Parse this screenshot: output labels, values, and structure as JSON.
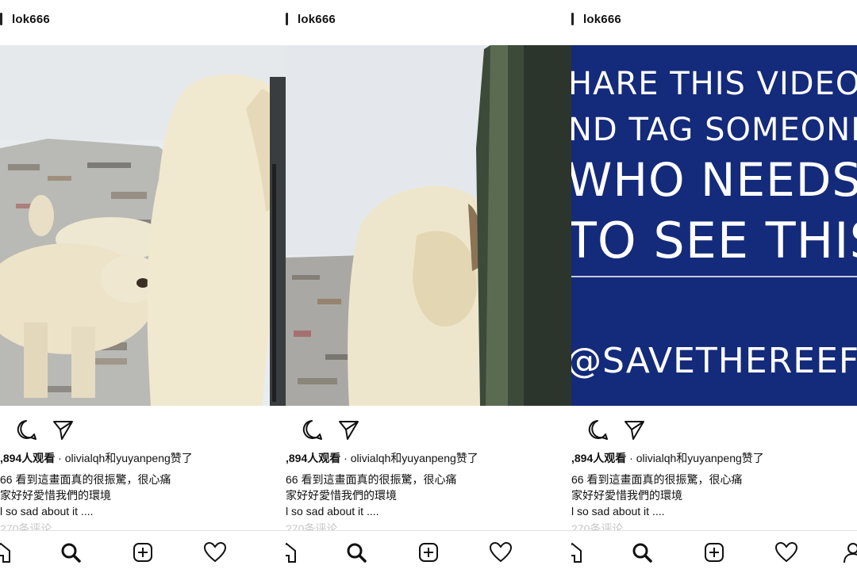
{
  "posts": [
    {
      "username": "lok666",
      "views_line": ",894人观看",
      "liked_by": " · olivialqh和yuyanpeng赞了",
      "caption_line1": "66 看到這畫面真的很振驚，很心痛",
      "caption_line2": "家好好愛惜我們的環境",
      "caption_line3": "l so sad about it ....",
      "comments_line": "270条评论"
    },
    {
      "username": "lok666",
      "views_line": ",894人观看",
      "liked_by": " · olivialqh和yuyanpeng赞了",
      "caption_line1": "66 看到這畫面真的很振驚，很心痛",
      "caption_line2": "家好好愛惜我們的環境",
      "caption_line3": "l so sad about it ....",
      "comments_line": "270条评论"
    },
    {
      "username": "lok666",
      "views_line": ",894人观看",
      "liked_by": " · olivialqh和yuyanpeng赞了",
      "caption_line1": "66 看到這畫面真的很振驚，很心痛",
      "caption_line2": "家好好愛惜我們的環境",
      "caption_line3": "l so sad about it ....",
      "comments_line": "270条评论"
    }
  ],
  "video_overlay_text": {
    "line1": "HARE THIS VIDEO",
    "line2": "ND TAG SOMEONE",
    "line3": "WHO NEEDS",
    "line4": "TO SEE THIS",
    "line5": "@SAVETHEREEF"
  },
  "colors": {
    "overlay_bg": "#142a7a",
    "text": "#111111",
    "muted": "#c7c7c7"
  },
  "icons": [
    "comment-icon",
    "share-icon",
    "home-icon",
    "search-icon",
    "add-icon",
    "heart-icon",
    "profile-icon"
  ]
}
